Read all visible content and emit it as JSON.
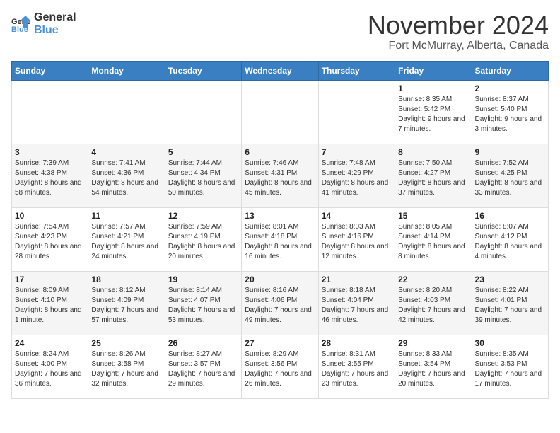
{
  "logo": {
    "general": "General",
    "blue": "Blue"
  },
  "header": {
    "month": "November 2024",
    "location": "Fort McMurray, Alberta, Canada"
  },
  "days_of_week": [
    "Sunday",
    "Monday",
    "Tuesday",
    "Wednesday",
    "Thursday",
    "Friday",
    "Saturday"
  ],
  "weeks": [
    [
      {
        "day": "",
        "info": ""
      },
      {
        "day": "",
        "info": ""
      },
      {
        "day": "",
        "info": ""
      },
      {
        "day": "",
        "info": ""
      },
      {
        "day": "",
        "info": ""
      },
      {
        "day": "1",
        "info": "Sunrise: 8:35 AM\nSunset: 5:42 PM\nDaylight: 9 hours and 7 minutes."
      },
      {
        "day": "2",
        "info": "Sunrise: 8:37 AM\nSunset: 5:40 PM\nDaylight: 9 hours and 3 minutes."
      }
    ],
    [
      {
        "day": "3",
        "info": "Sunrise: 7:39 AM\nSunset: 4:38 PM\nDaylight: 8 hours and 58 minutes."
      },
      {
        "day": "4",
        "info": "Sunrise: 7:41 AM\nSunset: 4:36 PM\nDaylight: 8 hours and 54 minutes."
      },
      {
        "day": "5",
        "info": "Sunrise: 7:44 AM\nSunset: 4:34 PM\nDaylight: 8 hours and 50 minutes."
      },
      {
        "day": "6",
        "info": "Sunrise: 7:46 AM\nSunset: 4:31 PM\nDaylight: 8 hours and 45 minutes."
      },
      {
        "day": "7",
        "info": "Sunrise: 7:48 AM\nSunset: 4:29 PM\nDaylight: 8 hours and 41 minutes."
      },
      {
        "day": "8",
        "info": "Sunrise: 7:50 AM\nSunset: 4:27 PM\nDaylight: 8 hours and 37 minutes."
      },
      {
        "day": "9",
        "info": "Sunrise: 7:52 AM\nSunset: 4:25 PM\nDaylight: 8 hours and 33 minutes."
      }
    ],
    [
      {
        "day": "10",
        "info": "Sunrise: 7:54 AM\nSunset: 4:23 PM\nDaylight: 8 hours and 28 minutes."
      },
      {
        "day": "11",
        "info": "Sunrise: 7:57 AM\nSunset: 4:21 PM\nDaylight: 8 hours and 24 minutes."
      },
      {
        "day": "12",
        "info": "Sunrise: 7:59 AM\nSunset: 4:19 PM\nDaylight: 8 hours and 20 minutes."
      },
      {
        "day": "13",
        "info": "Sunrise: 8:01 AM\nSunset: 4:18 PM\nDaylight: 8 hours and 16 minutes."
      },
      {
        "day": "14",
        "info": "Sunrise: 8:03 AM\nSunset: 4:16 PM\nDaylight: 8 hours and 12 minutes."
      },
      {
        "day": "15",
        "info": "Sunrise: 8:05 AM\nSunset: 4:14 PM\nDaylight: 8 hours and 8 minutes."
      },
      {
        "day": "16",
        "info": "Sunrise: 8:07 AM\nSunset: 4:12 PM\nDaylight: 8 hours and 4 minutes."
      }
    ],
    [
      {
        "day": "17",
        "info": "Sunrise: 8:09 AM\nSunset: 4:10 PM\nDaylight: 8 hours and 1 minute."
      },
      {
        "day": "18",
        "info": "Sunrise: 8:12 AM\nSunset: 4:09 PM\nDaylight: 7 hours and 57 minutes."
      },
      {
        "day": "19",
        "info": "Sunrise: 8:14 AM\nSunset: 4:07 PM\nDaylight: 7 hours and 53 minutes."
      },
      {
        "day": "20",
        "info": "Sunrise: 8:16 AM\nSunset: 4:06 PM\nDaylight: 7 hours and 49 minutes."
      },
      {
        "day": "21",
        "info": "Sunrise: 8:18 AM\nSunset: 4:04 PM\nDaylight: 7 hours and 46 minutes."
      },
      {
        "day": "22",
        "info": "Sunrise: 8:20 AM\nSunset: 4:03 PM\nDaylight: 7 hours and 42 minutes."
      },
      {
        "day": "23",
        "info": "Sunrise: 8:22 AM\nSunset: 4:01 PM\nDaylight: 7 hours and 39 minutes."
      }
    ],
    [
      {
        "day": "24",
        "info": "Sunrise: 8:24 AM\nSunset: 4:00 PM\nDaylight: 7 hours and 36 minutes."
      },
      {
        "day": "25",
        "info": "Sunrise: 8:26 AM\nSunset: 3:58 PM\nDaylight: 7 hours and 32 minutes."
      },
      {
        "day": "26",
        "info": "Sunrise: 8:27 AM\nSunset: 3:57 PM\nDaylight: 7 hours and 29 minutes."
      },
      {
        "day": "27",
        "info": "Sunrise: 8:29 AM\nSunset: 3:56 PM\nDaylight: 7 hours and 26 minutes."
      },
      {
        "day": "28",
        "info": "Sunrise: 8:31 AM\nSunset: 3:55 PM\nDaylight: 7 hours and 23 minutes."
      },
      {
        "day": "29",
        "info": "Sunrise: 8:33 AM\nSunset: 3:54 PM\nDaylight: 7 hours and 20 minutes."
      },
      {
        "day": "30",
        "info": "Sunrise: 8:35 AM\nSunset: 3:53 PM\nDaylight: 7 hours and 17 minutes."
      }
    ]
  ]
}
